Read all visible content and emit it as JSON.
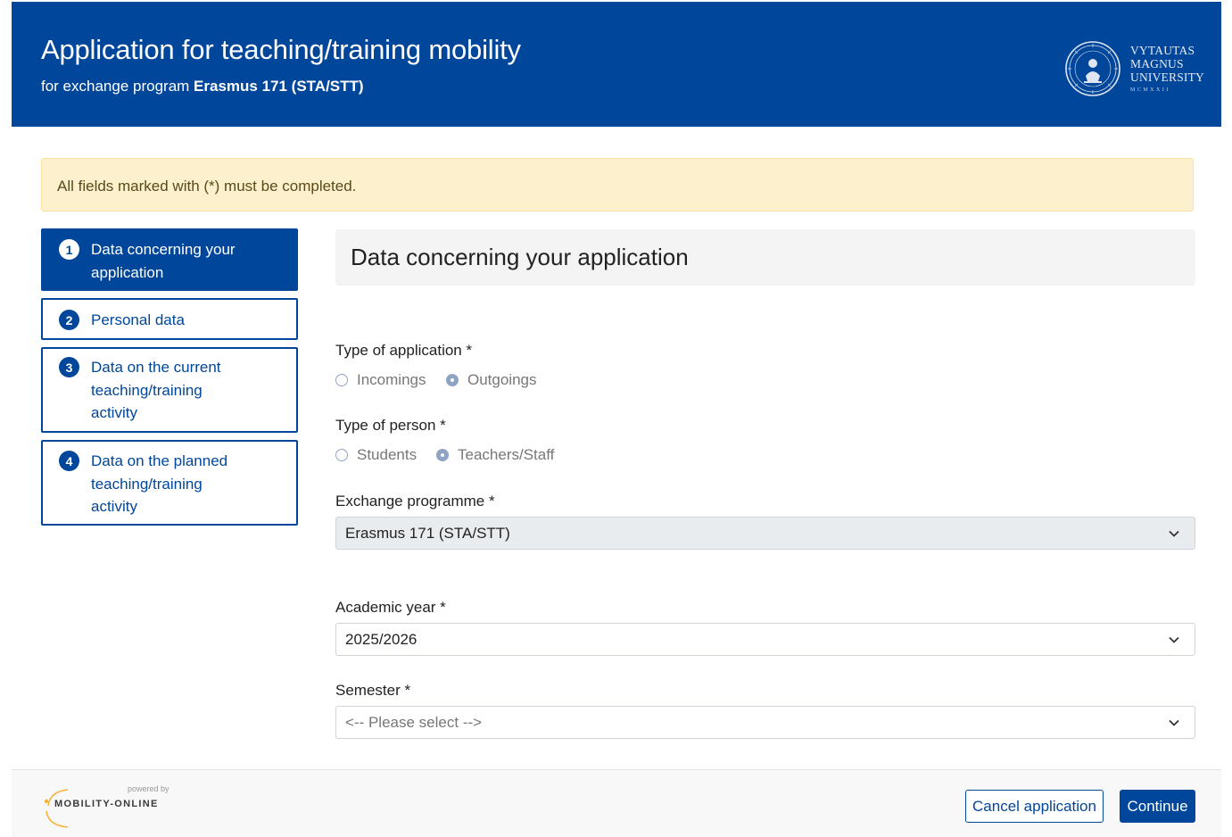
{
  "header": {
    "title": "Application for teaching/training mobility",
    "subtitle_prefix": "for exchange program ",
    "subtitle_program": "Erasmus 171 (STA/STT)",
    "logo_lines": [
      "VYTAUTAS",
      "MAGNUS",
      "UNIVERSITY"
    ],
    "logo_year": "MCMXXII"
  },
  "alert": {
    "text": "All fields marked with (*) must be completed."
  },
  "steps": [
    {
      "num": "1",
      "label_lines": [
        "Data concerning your",
        "application"
      ],
      "active": true
    },
    {
      "num": "2",
      "label_lines": [
        "Personal data"
      ],
      "active": false
    },
    {
      "num": "3",
      "label_lines": [
        "Data on the current",
        "teaching/training",
        "activity"
      ],
      "active": false
    },
    {
      "num": "4",
      "label_lines": [
        "Data on the planned",
        "teaching/training",
        "activity"
      ],
      "active": false
    }
  ],
  "panel": {
    "title": "Data concerning your application"
  },
  "form": {
    "type_of_application": {
      "label": "Type of application *",
      "options": [
        {
          "label": "Incomings",
          "selected": false
        },
        {
          "label": "Outgoings",
          "selected": true
        }
      ]
    },
    "type_of_person": {
      "label": "Type of person *",
      "options": [
        {
          "label": "Students",
          "selected": false
        },
        {
          "label": "Teachers/Staff",
          "selected": true
        }
      ]
    },
    "exchange_programme": {
      "label": "Exchange programme *",
      "value": "Erasmus 171 (STA/STT)"
    },
    "academic_year": {
      "label": "Academic year *",
      "value": "2025/2026"
    },
    "semester": {
      "label": "Semester *",
      "placeholder": "<-- Please select -->"
    }
  },
  "footer": {
    "powered_by": "powered by",
    "brand": "MOBILITY-ONLINE",
    "cancel_label": "Cancel application",
    "continue_label": "Continue"
  },
  "colors": {
    "primary": "#00469a",
    "alert_bg": "#fcf0cd"
  }
}
